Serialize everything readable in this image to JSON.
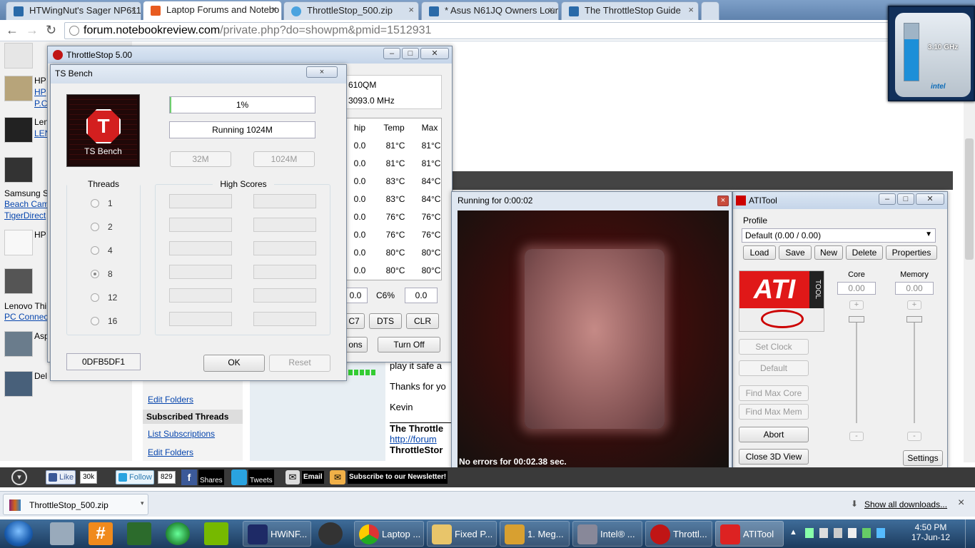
{
  "browser": {
    "tabs": [
      "HTWingNut's Sager NP611",
      "Laptop Forums and Notebo",
      "ThrottleStop_500.zip",
      "* Asus N61JQ Owners Loun",
      "The ThrottleStop Guide"
    ],
    "tab_close": "×",
    "url_host": "forum.notebookreview.com",
    "url_path": "/private.php?do=showpm&pmid=1512931"
  },
  "sidebar": {
    "items": [
      {
        "label": "HP",
        "links": [
          "HP",
          "P.C"
        ]
      },
      {
        "label": "Len",
        "links": [
          "LEN"
        ]
      },
      {
        "label": "Samsung S",
        "links": [
          "Beach Cam",
          "TigerDirect"
        ]
      },
      {
        "label": "HP",
        "links": []
      },
      {
        "label": "Lenovo Thi",
        "links": [
          "PC Connec"
        ]
      },
      {
        "label": "Asp",
        "links": []
      },
      {
        "label": "Del",
        "links": []
      }
    ]
  },
  "forum": {
    "links": [
      "Edit Folders",
      "List Subscriptions",
      "Edit Folders"
    ],
    "section": "Subscribed Threads",
    "post_lines": [
      "play it safe a",
      "Thanks for yo",
      "Kevin",
      "The Throttle",
      "http://forum",
      "ThrottleStor"
    ]
  },
  "throttlestop": {
    "title": "ThrottleStop 5.00",
    "cpu": "610QM",
    "speed": "3093.0 MHz",
    "headers": [
      "hip",
      "Temp",
      "Max"
    ],
    "rows": [
      [
        "0.0",
        "81°C",
        "81°C"
      ],
      [
        "0.0",
        "81°C",
        "81°C"
      ],
      [
        "0.0",
        "83°C",
        "84°C"
      ],
      [
        "0.0",
        "83°C",
        "84°C"
      ],
      [
        "0.0",
        "76°C",
        "76°C"
      ],
      [
        "0.0",
        "76°C",
        "76°C"
      ],
      [
        "0.0",
        "80°C",
        "80°C"
      ],
      [
        "0.0",
        "80°C",
        "80°C"
      ]
    ],
    "c6_field": "0.0",
    "c6_label": "C6%",
    "c6_val": "0.0",
    "btns": [
      "C7",
      "DTS",
      "CLR"
    ],
    "options": "ons",
    "turnoff": "Turn Off"
  },
  "tsbench": {
    "title": "TS Bench",
    "logo_label": "TS Bench",
    "logo_letter": "T",
    "progress": "1%",
    "progress_fraction": 0.01,
    "status": "Running 1024M",
    "size_min": "32M",
    "size_max": "1024M",
    "threads_label": "Threads",
    "threads": [
      "1",
      "2",
      "4",
      "8",
      "12",
      "16"
    ],
    "threads_selected": "8",
    "scores_label": "High Scores",
    "id": "0DFB5DF1",
    "ok": "OK",
    "reset": "Reset",
    "close": "×"
  },
  "render": {
    "title": "Running for 0:00:02",
    "status": "No errors for 00:02.38 sec.",
    "close": "×"
  },
  "atitool": {
    "title": "ATITool",
    "profile_label": "Profile",
    "profile_value": "Default (0.00 / 0.00)",
    "profile_btns": [
      "Load",
      "Save",
      "New",
      "Delete",
      "Properties"
    ],
    "core_label": "Core",
    "memory_label": "Memory",
    "core_val": "0.00",
    "memory_val": "0.00",
    "plus": "+",
    "minus": "-",
    "logo_text": "ATI",
    "logo_sub": "TOOL",
    "side_btns": [
      "Set Clock",
      "Default",
      "Find Max Core",
      "Find Max Mem",
      "Abort",
      "Close 3D View"
    ],
    "settings": "Settings"
  },
  "intel_widget": {
    "speed": "3.10 GHz",
    "brand": "intel",
    "fill_fraction": 0.72
  },
  "sharebar": {
    "like": "Like",
    "like_count": "30k",
    "follow": "Follow",
    "follow_count": "829",
    "shares": "Shares",
    "tweets": "Tweets",
    "email": "Email",
    "newsletter": "Subscribe to our Newsletter!"
  },
  "downloads": {
    "file": "ThrottleStop_500.zip",
    "show_all": "Show all downloads...",
    "close": "×"
  },
  "taskbar": {
    "items": [
      "HWiNF...",
      "Laptop ...",
      "Fixed P...",
      "1. Meg...",
      "Intel® ...",
      "Throttl...",
      "ATITool"
    ],
    "time": "4:50 PM",
    "date": "17-Jun-12"
  }
}
